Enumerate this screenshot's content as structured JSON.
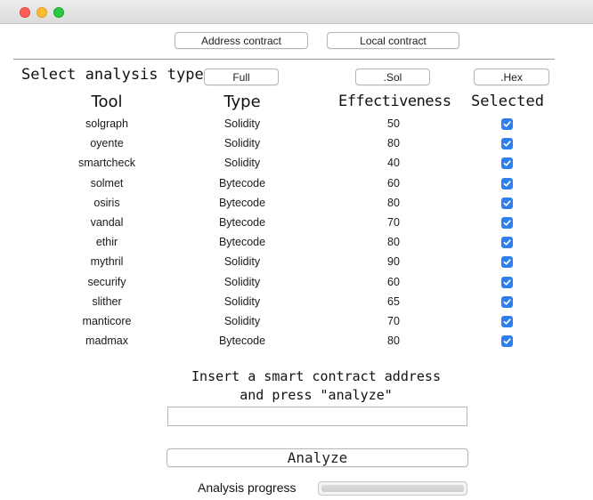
{
  "window": {
    "close_color": "#ff5f57",
    "minimize_color": "#febc2e",
    "maximize_color": "#28c840"
  },
  "source_buttons": {
    "address": "Address contract",
    "local": "Local contract"
  },
  "analysis_type": {
    "label": "Select analysis type",
    "full": "Full",
    "sol": ".Sol",
    "hex": ".Hex"
  },
  "table": {
    "headers": {
      "tool": "Tool",
      "type": "Type",
      "effectiveness": "Effectiveness",
      "selected": "Selected"
    },
    "rows": [
      {
        "tool": "solgraph",
        "type": "Solidity",
        "effectiveness": "50",
        "selected": true
      },
      {
        "tool": "oyente",
        "type": "Solidity",
        "effectiveness": "80",
        "selected": true
      },
      {
        "tool": "smartcheck",
        "type": "Solidity",
        "effectiveness": "40",
        "selected": true
      },
      {
        "tool": "solmet",
        "type": "Bytecode",
        "effectiveness": "60",
        "selected": true
      },
      {
        "tool": "osiris",
        "type": "Bytecode",
        "effectiveness": "80",
        "selected": true
      },
      {
        "tool": "vandal",
        "type": "Bytecode",
        "effectiveness": "70",
        "selected": true
      },
      {
        "tool": "ethir",
        "type": "Bytecode",
        "effectiveness": "80",
        "selected": true
      },
      {
        "tool": "mythril",
        "type": "Solidity",
        "effectiveness": "90",
        "selected": true
      },
      {
        "tool": "securify",
        "type": "Solidity",
        "effectiveness": "60",
        "selected": true
      },
      {
        "tool": "slither",
        "type": "Solidity",
        "effectiveness": "65",
        "selected": true
      },
      {
        "tool": "manticore",
        "type": "Solidity",
        "effectiveness": "70",
        "selected": true
      },
      {
        "tool": "madmax",
        "type": "Bytecode",
        "effectiveness": "80",
        "selected": true
      }
    ]
  },
  "address_input": {
    "prompt_line1": "Insert a smart contract address",
    "prompt_line2": "and press \"analyze\"",
    "value": ""
  },
  "analyze_button": "Analyze",
  "progress": {
    "label": "Analysis progress",
    "value": 0
  },
  "colors": {
    "checkbox": "#2f7ff0"
  }
}
